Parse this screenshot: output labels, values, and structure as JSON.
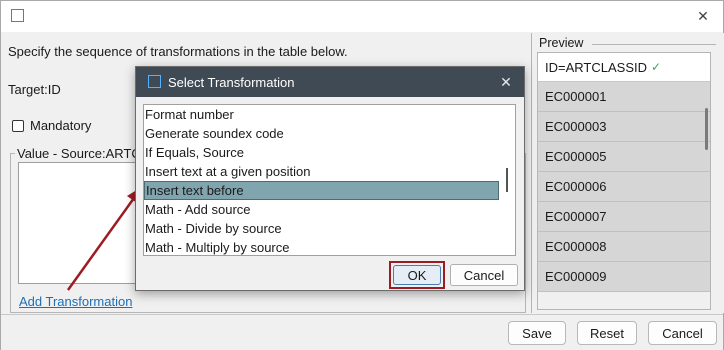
{
  "window": {
    "close_glyph": "✕"
  },
  "main": {
    "instructions": "Specify the sequence of transformations in the table below.",
    "target": "Target:ID",
    "mandatory_label": "Mandatory",
    "group_title": "Value - Source:ARTC",
    "add_transformation": "Add Transformation"
  },
  "preview": {
    "title": "Preview",
    "header": "ID=ARTCLASSID",
    "header_check": "✓",
    "rows": [
      "EC000001",
      "EC000003",
      "EC000005",
      "EC000006",
      "EC000007",
      "EC000008",
      "EC000009"
    ]
  },
  "footer": {
    "save": "Save",
    "reset": "Reset",
    "cancel": "Cancel"
  },
  "dialog": {
    "title": "Select Transformation",
    "close_glyph": "✕",
    "items": [
      "Format number",
      "Generate soundex code",
      "If Equals, Source",
      "Insert text at a given position",
      "Insert text before",
      "Math - Add source",
      "Math - Divide by source",
      "Math - Multiply by source"
    ],
    "selected_index": 4,
    "ok": "OK",
    "cancel": "Cancel"
  },
  "colors": {
    "highlight": "#9e1b24",
    "selection": "#80a5ae",
    "dialog_title_bar": "#3f4a55",
    "link": "#1b6fb8"
  }
}
